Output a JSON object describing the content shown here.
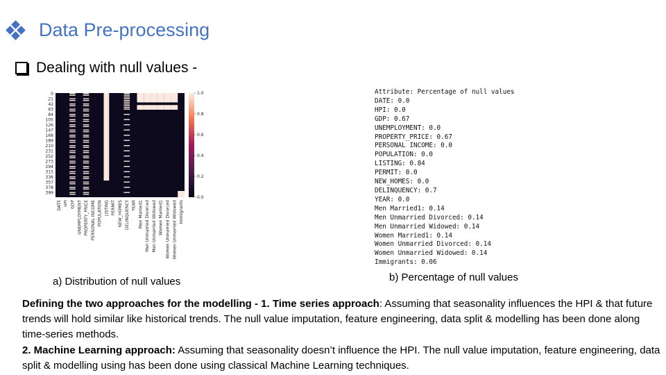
{
  "slide": {
    "title": "Data Pre-processing",
    "subtitle": "Dealing with null values -",
    "caption_a": "a) Distribution of null values",
    "caption_b": "b) Percentage of null values"
  },
  "chart_data": {
    "type": "heatmap",
    "columns": [
      "DATE",
      "HPI",
      "GDP",
      "UNEMPLOYMENT",
      "PROPERTY_PRICE",
      "PERSONAL INCOME",
      "POPULATION",
      "LISTING",
      "PERMIT",
      "NEW_HOMES",
      "DELINQUENCY",
      "YEAR",
      "Men Married1",
      "Men Unmarried Divorced",
      "Men Unmarried Widowed",
      "Women Married1",
      "Women Unmarried Divorced",
      "Women Unmarried Widowed",
      "Immigrants"
    ],
    "row_ticks": [
      "0",
      "21",
      "42",
      "63",
      "84",
      "105",
      "126",
      "147",
      "168",
      "189",
      "210",
      "231",
      "252",
      "273",
      "294",
      "315",
      "336",
      "357",
      "378",
      "399"
    ],
    "colorbar_ticks": [
      "1.0",
      "0.8",
      "0.6",
      "0.4",
      "0.2",
      "0.0"
    ],
    "null_fraction": [
      0.0,
      0.0,
      0.67,
      0.0,
      0.67,
      0.0,
      0.0,
      0.84,
      0.0,
      0.0,
      0.7,
      0.0,
      0.14,
      0.14,
      0.14,
      0.14,
      0.14,
      0.14,
      0.06
    ],
    "xlabel": "",
    "ylabel": ""
  },
  "null_percentages": {
    "header": "Attribute: Percentage of null values",
    "items": [
      "DATE: 0.0",
      "HPI: 0.0",
      "GDP: 0.67",
      "UNEMPLOYMENT: 0.0",
      "PROPERTY_PRICE: 0.67",
      "PERSONAL INCOME: 0.0",
      "POPULATION: 0.0",
      "LISTING: 0.84",
      "PERMIT: 0.0",
      "NEW_HOMES: 0.0",
      "DELINQUENCY: 0.7",
      "YEAR: 0.0",
      "Men Married1: 0.14",
      "Men Unmarried Divorced: 0.14",
      "Men Unmarried Widowed: 0.14",
      "Women Married1: 0.14",
      "Women Unmarried Divorced: 0.14",
      "Women Unmarried Widowed: 0.14",
      "Immigrants: 0.06"
    ]
  },
  "body": {
    "p1_bold": "Defining the two approaches for the modelling - 1. Time series approach",
    "p1_text": ": Assuming that seasonality influences the HPI & that future trends will hold similar like historical trends. The null value imputation, feature engineering, data split & modelling has been done along time-series methods.",
    "p2_bold": "2. Machine Learning approach:",
    "p2_text": " Assuming that seasonality doesn’t influence the HPI. The null value imputation, feature engineering, data split & modelling using has been done using classical Machine Learning techniques."
  },
  "colors": {
    "accent": "#4472c4",
    "present": "#0d0a1e",
    "missing": "#fbe9e1"
  }
}
